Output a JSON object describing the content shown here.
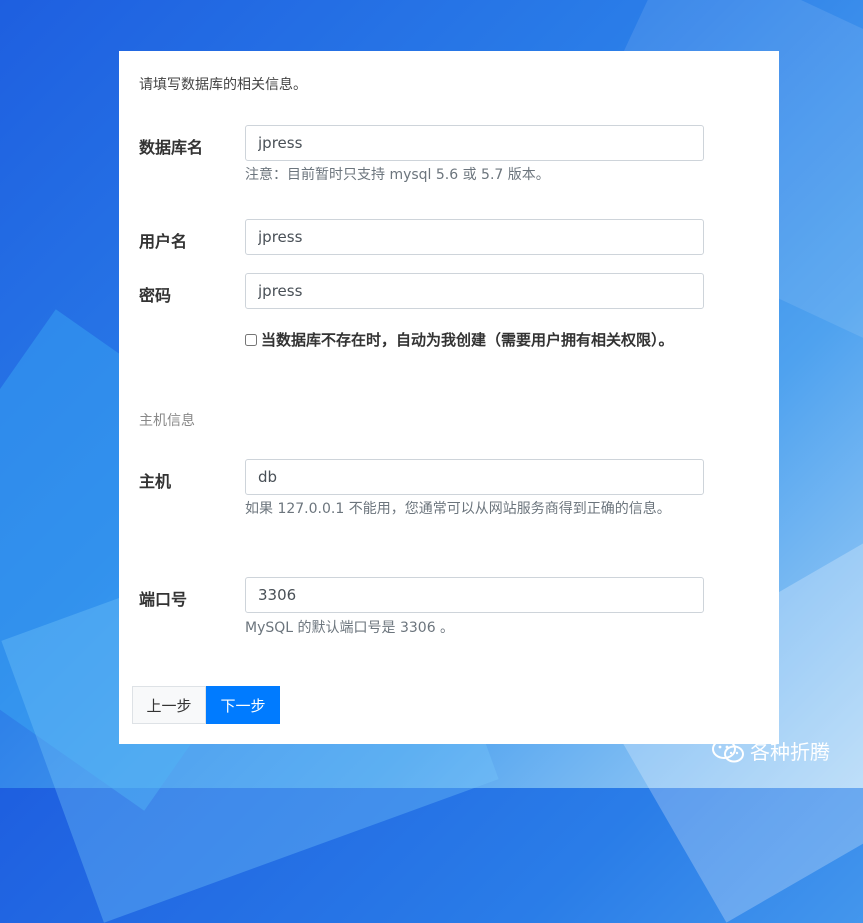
{
  "intro": "请填写数据库的相关信息。",
  "fields": {
    "dbname": {
      "label": "数据库名",
      "value": "jpress",
      "help": "注意：目前暂时只支持 mysql 5.6 或 5.7 版本。"
    },
    "username": {
      "label": "用户名",
      "value": "jpress"
    },
    "password": {
      "label": "密码",
      "value": "jpress"
    },
    "host": {
      "label": "主机",
      "value": "db",
      "help": "如果 127.0.0.1 不能用，您通常可以从网站服务商得到正确的信息。"
    },
    "port": {
      "label": "端口号",
      "value": "3306",
      "help": "MySQL 的默认端口号是 3306 。"
    }
  },
  "create_db_checkbox": {
    "label": "当数据库不存在时，自动为我创建（需要用户拥有相关权限）。",
    "checked": false
  },
  "host_section_title": "主机信息",
  "buttons": {
    "prev": "上一步",
    "next": "下一步"
  },
  "watermark": {
    "text": "各种折腾",
    "icon": "wechat-icon"
  },
  "colors": {
    "primary": "#007bff",
    "background_gradient_start": "#1e5fe0",
    "background_gradient_end": "#a9d4f7"
  }
}
